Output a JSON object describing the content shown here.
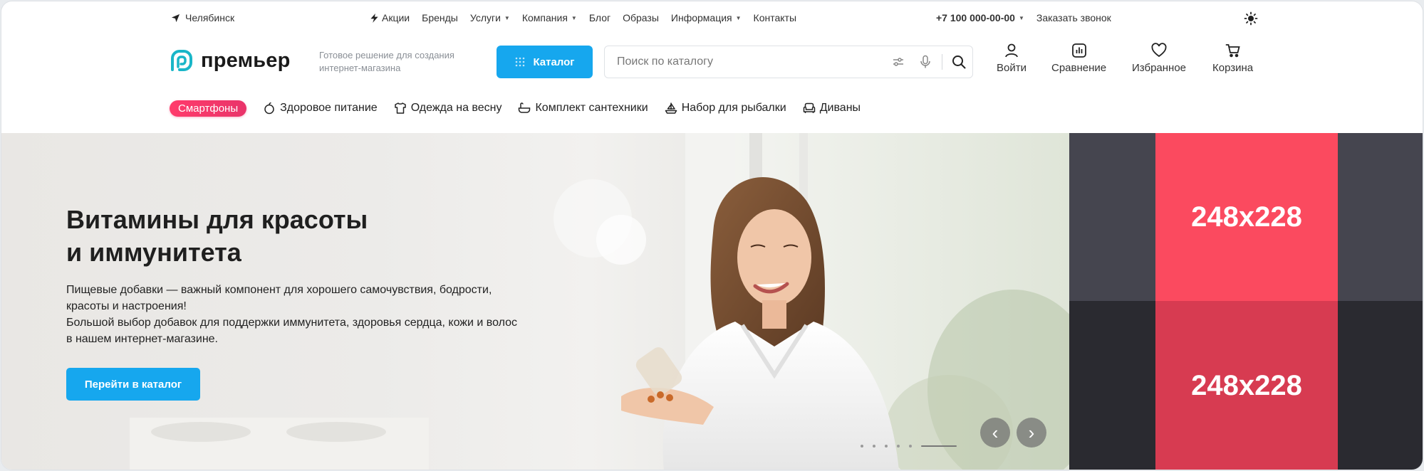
{
  "topbar": {
    "city": "Челябинск",
    "nav": [
      {
        "label": "Акции",
        "icon": "bolt-icon"
      },
      {
        "label": "Бренды"
      },
      {
        "label": "Услуги",
        "dropdown": true
      },
      {
        "label": "Компания",
        "dropdown": true
      },
      {
        "label": "Блог"
      },
      {
        "label": "Образы"
      },
      {
        "label": "Информация",
        "dropdown": true
      },
      {
        "label": "Контакты"
      }
    ],
    "phone": "+7 100 000-00-00",
    "callback": "Заказать звонок"
  },
  "header": {
    "logo": "премьер",
    "tagline": "Готовое решение для создания интернет-магазина",
    "catalog_label": "Каталог",
    "search_placeholder": "Поиск по каталогу",
    "actions": {
      "login": "Войти",
      "compare": "Сравнение",
      "favorites": "Избранное",
      "cart": "Корзина"
    }
  },
  "categories": [
    {
      "label": "Смартфоны",
      "highlight": true
    },
    {
      "label": "Здоровое питание",
      "icon": "fruit-icon"
    },
    {
      "label": "Одежда на весну",
      "icon": "shirt-icon"
    },
    {
      "label": "Комплект сантехники",
      "icon": "bath-icon"
    },
    {
      "label": "Набор для рыбалки",
      "icon": "boat-icon"
    },
    {
      "label": "Диваны",
      "icon": "sofa-icon"
    }
  ],
  "banner": {
    "title_line1": "Витамины для красоты",
    "title_line2": "и иммунитета",
    "text_line1": "Пищевые добавки — важный компонент для хорошего самочувствия, бодрости,",
    "text_line2": "красоты и настроения!",
    "text_line3": "Большой выбор добавок для поддержки иммунитета, здоровья сердца, кожи и волос",
    "text_line4": "в нашем интернет-магазине.",
    "button": "Перейти в каталог",
    "slide_count": 6,
    "active_slide": 6
  },
  "promos": [
    {
      "label": "248x228",
      "accent": "#fb4a5f",
      "side": "#45454f"
    },
    {
      "label": "248x228",
      "accent": "#d73b51",
      "side": "#2a2a30"
    }
  ],
  "colors": {
    "accent": "#16a7ee",
    "hot": "#e9346a"
  }
}
